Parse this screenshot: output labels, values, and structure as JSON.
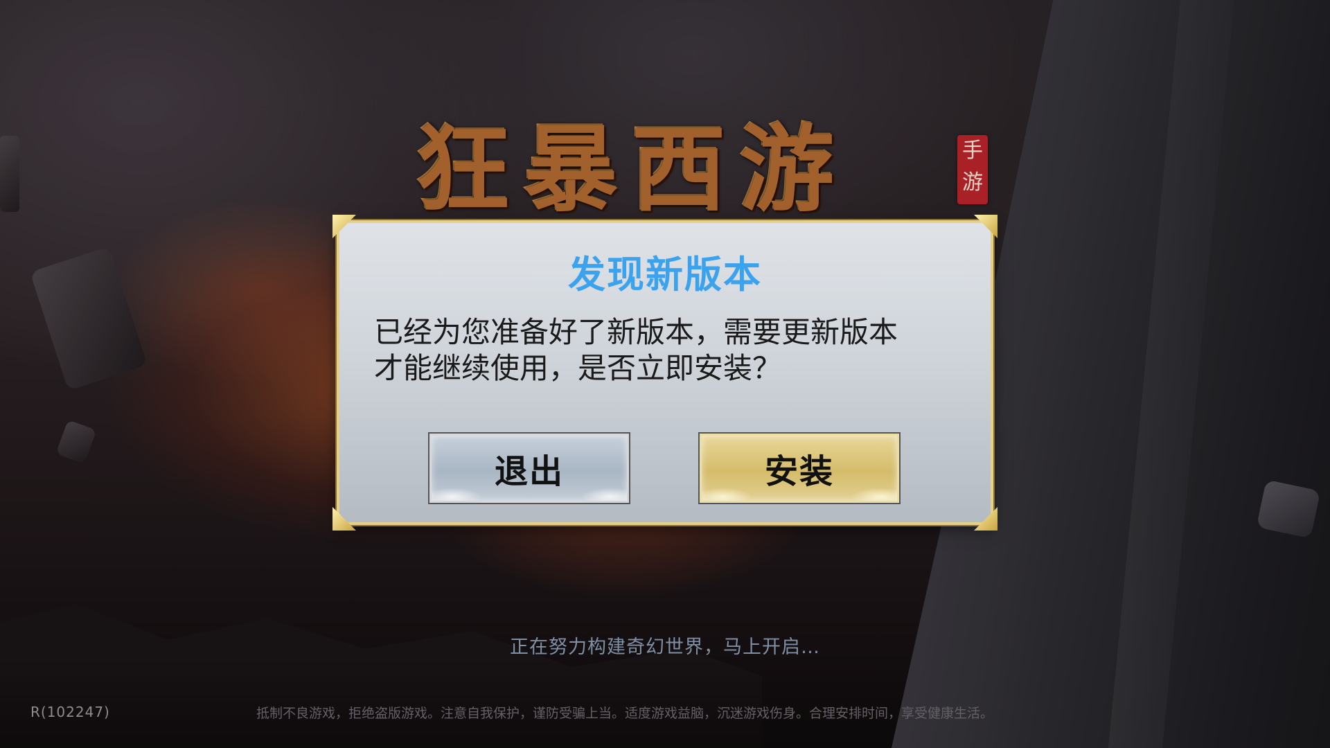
{
  "background": {
    "logo_text": "狂暴西游",
    "logo_seal": "手游",
    "loading_text": "正在努力构建奇幻世界，马上开启…",
    "version_label": "R(102247)",
    "health_advisory": "抵制不良游戏，拒绝盗版游戏。注意自我保护，谨防受骗上当。适度游戏益脑，沉迷游戏伤身。合理安排时间，享受健康生活。"
  },
  "dialog": {
    "title": "发现新版本",
    "message_line1": "已经为您准备好了新版本，需要更新版本",
    "message_line2": "才能继续使用，是否立即安装？",
    "exit_button": "退出",
    "install_button": "安装"
  },
  "colors": {
    "title_blue": "#3ba3ee",
    "frame_gold": "#e6d089",
    "exit_button": "#b4c0cc",
    "install_button": "#dcc67c"
  }
}
